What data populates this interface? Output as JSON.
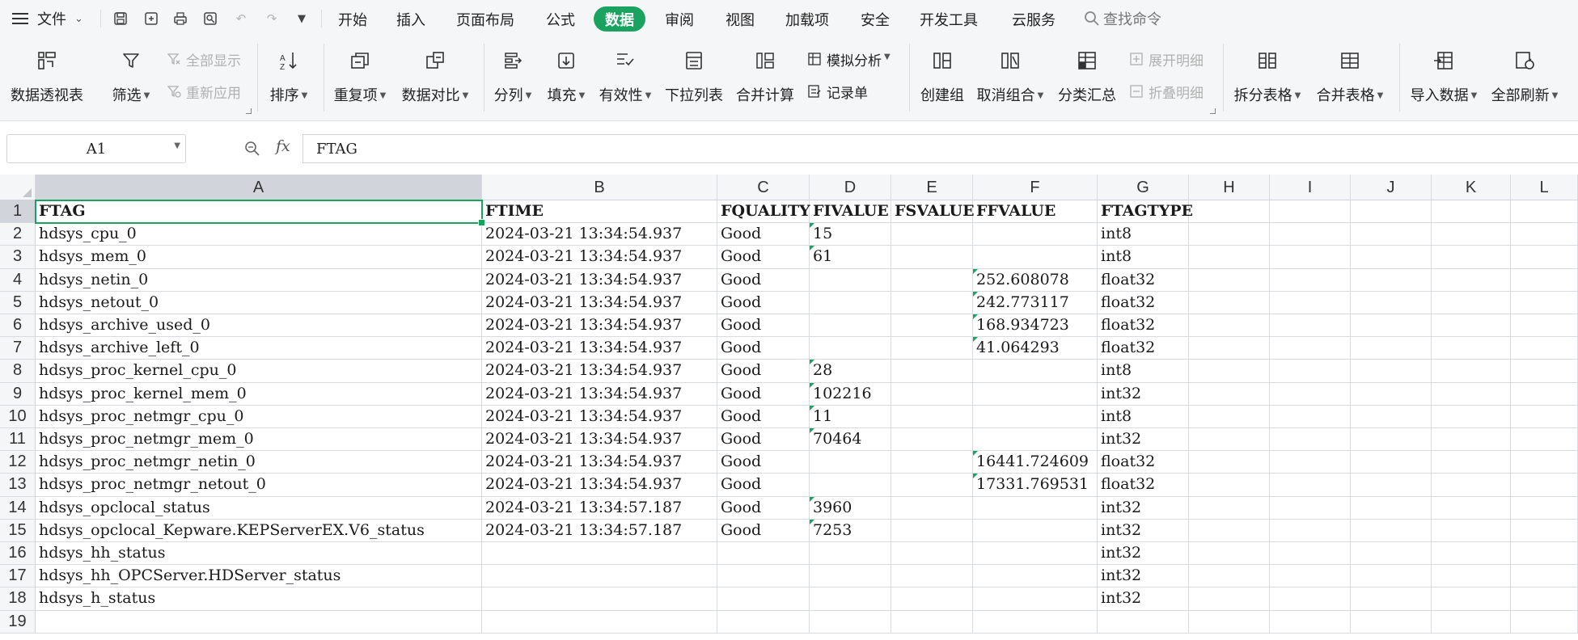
{
  "menubar": {
    "file_label": "文件",
    "tabs": [
      "开始",
      "插入",
      "页面布局",
      "公式",
      "数据",
      "审阅",
      "视图",
      "加载项",
      "安全",
      "开发工具",
      "云服务"
    ],
    "active_tab": "数据",
    "search_placeholder": "查找命令"
  },
  "ribbon": {
    "pivot": "数据透视表",
    "filter": "筛选",
    "show_all": "全部显示",
    "reapply": "重新应用",
    "sort": "排序",
    "duplicates": "重复项",
    "compare": "数据对比",
    "split": "分列",
    "fill": "填充",
    "validity": "有效性",
    "dropdown_list": "下拉列表",
    "consolidate": "合并计算",
    "what_if": "模拟分析",
    "record_form": "记录单",
    "group": "创建组",
    "ungroup": "取消组合",
    "subtotal": "分类汇总",
    "expand_detail": "展开明细",
    "collapse_detail": "折叠明细",
    "split_table": "拆分表格",
    "merge_table": "合并表格",
    "import_data": "导入数据",
    "refresh_all": "全部刷新"
  },
  "formula_bar": {
    "name_box": "A1",
    "fx": "fx",
    "content": "FTAG"
  },
  "sheet": {
    "columns": [
      "A",
      "B",
      "C",
      "D",
      "E",
      "F",
      "G",
      "H",
      "I",
      "J",
      "K",
      "L"
    ],
    "row_numbers": [
      "1",
      "2",
      "3",
      "4",
      "5",
      "6",
      "7",
      "8",
      "9",
      "10",
      "11",
      "12",
      "13",
      "14",
      "15",
      "16",
      "17",
      "18",
      "19"
    ],
    "rows": [
      [
        "FTAG",
        "FTIME",
        "FQUALITY",
        "FIVALUE",
        "FSVALUE",
        "FFVALUE",
        "FTAGTYPE"
      ],
      [
        "hdsys_cpu_0",
        "2024-03-21 13:34:54.937",
        "Good",
        "15",
        "",
        "",
        "int8"
      ],
      [
        "hdsys_mem_0",
        "2024-03-21 13:34:54.937",
        "Good",
        "61",
        "",
        "",
        "int8"
      ],
      [
        "hdsys_netin_0",
        "2024-03-21 13:34:54.937",
        "Good",
        "",
        "",
        "252.608078",
        "float32"
      ],
      [
        "hdsys_netout_0",
        "2024-03-21 13:34:54.937",
        "Good",
        "",
        "",
        "242.773117",
        "float32"
      ],
      [
        "hdsys_archive_used_0",
        "2024-03-21 13:34:54.937",
        "Good",
        "",
        "",
        "168.934723",
        "float32"
      ],
      [
        "hdsys_archive_left_0",
        "2024-03-21 13:34:54.937",
        "Good",
        "",
        "",
        "41.064293",
        "float32"
      ],
      [
        "hdsys_proc_kernel_cpu_0",
        "2024-03-21 13:34:54.937",
        "Good",
        "28",
        "",
        "",
        "int8"
      ],
      [
        "hdsys_proc_kernel_mem_0",
        "2024-03-21 13:34:54.937",
        "Good",
        "102216",
        "",
        "",
        "int32"
      ],
      [
        "hdsys_proc_netmgr_cpu_0",
        "2024-03-21 13:34:54.937",
        "Good",
        "11",
        "",
        "",
        "int8"
      ],
      [
        "hdsys_proc_netmgr_mem_0",
        "2024-03-21 13:34:54.937",
        "Good",
        "70464",
        "",
        "",
        "int32"
      ],
      [
        "hdsys_proc_netmgr_netin_0",
        "2024-03-21 13:34:54.937",
        "Good",
        "",
        "",
        "16441.724609",
        "float32"
      ],
      [
        "hdsys_proc_netmgr_netout_0",
        "2024-03-21 13:34:54.937",
        "Good",
        "",
        "",
        "17331.769531",
        "float32"
      ],
      [
        "hdsys_opclocal_status",
        "2024-03-21 13:34:57.187",
        "Good",
        "3960",
        "",
        "",
        "int32"
      ],
      [
        "hdsys_opclocal_Kepware.KEPServerEX.V6_status",
        "2024-03-21 13:34:57.187",
        "Good",
        "7253",
        "",
        "",
        "int32"
      ],
      [
        "hdsys_hh_status",
        "",
        "",
        "",
        "",
        "",
        "int32"
      ],
      [
        "hdsys_hh_OPCServer.HDServer_status",
        "",
        "",
        "",
        "",
        "",
        "int32"
      ],
      [
        "hdsys_h_status",
        "",
        "",
        "",
        "",
        "",
        "int32"
      ],
      [
        "",
        "",
        "",
        "",
        "",
        "",
        ""
      ]
    ]
  },
  "colors": {
    "accent": "#1aa260",
    "toolbar_bg": "#f5f6f7",
    "selected_header": "#d1d4da"
  }
}
